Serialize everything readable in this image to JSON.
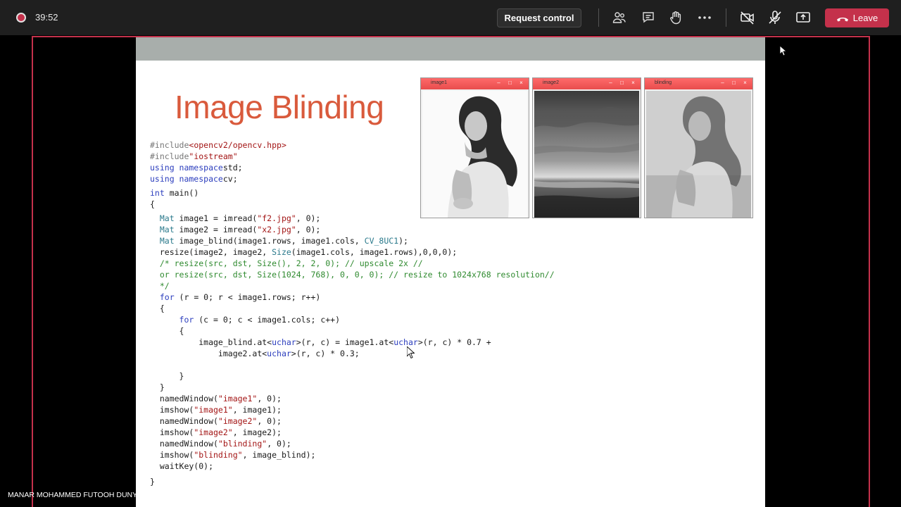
{
  "meeting": {
    "recording_time": "39:52",
    "request_control_label": "Request control",
    "leave_label": "Leave",
    "presenter_name": "MANAR MOHAMMED FUTOOH DUNYA",
    "accent_color": "#c4314b"
  },
  "toolbar_icons": [
    "people-icon",
    "chat-icon",
    "raise-hand-icon",
    "more-icon",
    "camera-off-icon",
    "mic-off-icon",
    "share-tray-icon"
  ],
  "slide": {
    "title": "Image Blinding",
    "windows": [
      {
        "title": "image1"
      },
      {
        "title": "image2"
      },
      {
        "title": "blinding"
      }
    ],
    "code": [
      [
        [
          "pp",
          "#include"
        ],
        [
          "st",
          "<opencv2/opencv.hpp>"
        ]
      ],
      [
        [
          "pp",
          "#include"
        ],
        [
          "st",
          "\"iostream\""
        ]
      ],
      [
        [
          "kw",
          "using namespace"
        ],
        [
          "",
          "std;"
        ]
      ],
      [
        [
          "kw",
          "using namespace"
        ],
        [
          "",
          "cv;"
        ]
      ],
      [
        [
          "kw",
          "int"
        ],
        [
          "",
          " main()"
        ]
      ],
      [
        [
          "",
          "{"
        ]
      ],
      [
        [
          "ty",
          "  Mat"
        ],
        [
          "",
          " image1 = imread("
        ],
        [
          "st",
          "\"f2.jpg\""
        ],
        [
          "",
          ", 0);"
        ]
      ],
      [
        [
          "ty",
          "  Mat"
        ],
        [
          "",
          " image2 = imread("
        ],
        [
          "st",
          "\"x2.jpg\""
        ],
        [
          "",
          ", 0);"
        ]
      ],
      [
        [
          "ty",
          "  Mat"
        ],
        [
          "",
          " image_blind(image1.rows, image1.cols, "
        ],
        [
          "ty",
          "CV_8UC1"
        ],
        [
          "",
          ");"
        ]
      ],
      [
        [
          "",
          "  resize(image2, image2, "
        ],
        [
          "ty",
          "Size"
        ],
        [
          "",
          "(image1.cols, image1.rows),0,0,0);"
        ]
      ],
      [
        [
          "cm",
          "  /* resize(src, dst, Size(), 2, 2, 0); // upscale 2x //"
        ]
      ],
      [
        [
          "cm",
          "  or resize(src, dst, Size(1024, 768), 0, 0, 0); // resize to 1024x768 resolution//"
        ]
      ],
      [
        [
          "cm",
          "  */"
        ]
      ],
      [
        [
          "kw",
          "  for"
        ],
        [
          "",
          " (r = 0; r < image1.rows; r++)"
        ]
      ],
      [
        [
          "",
          "  {"
        ]
      ],
      [
        [
          "kw",
          "      for"
        ],
        [
          "",
          " (c = 0; c < image1.cols; c++)"
        ]
      ],
      [
        [
          "",
          "      {"
        ]
      ],
      [
        [
          "",
          "          image_blind.at<"
        ],
        [
          "kw",
          "uchar"
        ],
        [
          "",
          ">(r, c) = image1.at<"
        ],
        [
          "kw",
          "uchar"
        ],
        [
          "",
          ">(r, c) * 0.7 +"
        ]
      ],
      [
        [
          "",
          "              image2.at<"
        ],
        [
          "kw",
          "uchar"
        ],
        [
          "",
          ">(r, c) * 0.3;"
        ]
      ],
      [
        [
          "",
          ""
        ]
      ],
      [
        [
          "",
          "      }"
        ]
      ],
      [
        [
          "",
          "  }"
        ]
      ],
      [
        [
          "",
          "  namedWindow("
        ],
        [
          "st",
          "\"image1\""
        ],
        [
          "",
          ", 0);"
        ]
      ],
      [
        [
          "",
          "  imshow("
        ],
        [
          "st",
          "\"image1\""
        ],
        [
          "",
          ", image1);"
        ]
      ],
      [
        [
          "",
          "  namedWindow("
        ],
        [
          "st",
          "\"image2\""
        ],
        [
          "",
          ", 0);"
        ]
      ],
      [
        [
          "",
          "  imshow("
        ],
        [
          "st",
          "\"image2\""
        ],
        [
          "",
          ", image2);"
        ]
      ],
      [
        [
          "",
          "  namedWindow("
        ],
        [
          "st",
          "\"blinding\""
        ],
        [
          "",
          ", 0);"
        ]
      ],
      [
        [
          "",
          "  imshow("
        ],
        [
          "st",
          "\"blinding\""
        ],
        [
          "",
          ", image_blind);"
        ]
      ],
      [
        [
          "",
          "  waitKey(0);"
        ]
      ],
      [
        [
          "",
          ""
        ]
      ],
      [
        [
          "",
          "}"
        ]
      ]
    ]
  }
}
